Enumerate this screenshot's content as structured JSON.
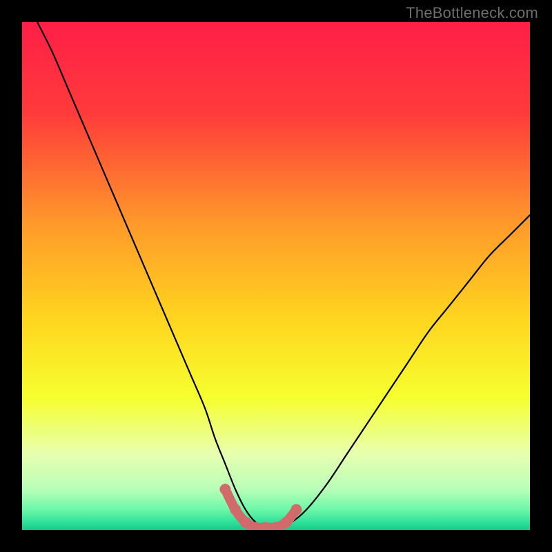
{
  "watermark": "TheBottleneck.com",
  "colors": {
    "curve": "#000000",
    "highlight": "#d16a6a",
    "frame": "#000000"
  },
  "chart_data": {
    "type": "line",
    "title": "",
    "xlabel": "",
    "ylabel": "",
    "xlim": [
      0,
      100
    ],
    "ylim": [
      0,
      100
    ],
    "grid": false,
    "series": [
      {
        "name": "bottleneck-curve",
        "x": [
          3,
          6,
          9,
          12,
          15,
          18,
          21,
          24,
          27,
          30,
          33,
          36,
          38,
          40,
          42,
          44,
          46,
          48,
          50,
          53,
          56,
          60,
          64,
          68,
          72,
          76,
          80,
          84,
          88,
          92,
          96,
          100
        ],
        "y": [
          100,
          94,
          87,
          80,
          73,
          66,
          59,
          52,
          45,
          38,
          31,
          24,
          18,
          13,
          8,
          4,
          1.5,
          0.5,
          0.5,
          1.5,
          4,
          9,
          15,
          21,
          27,
          33,
          39,
          44,
          49,
          54,
          58,
          62
        ]
      }
    ],
    "highlight_segment": {
      "name": "flat-minimum",
      "x": [
        40,
        42,
        44,
        46,
        48,
        50,
        52,
        54
      ],
      "y": [
        8,
        4,
        1.5,
        0.5,
        0.5,
        0.5,
        1.5,
        4
      ]
    },
    "background_gradient": {
      "stops": [
        {
          "offset": 0.0,
          "color": "#ff1f47"
        },
        {
          "offset": 0.18,
          "color": "#ff3b3b"
        },
        {
          "offset": 0.4,
          "color": "#ff9a2a"
        },
        {
          "offset": 0.58,
          "color": "#ffd41f"
        },
        {
          "offset": 0.74,
          "color": "#f6ff2e"
        },
        {
          "offset": 0.85,
          "color": "#e8ffb0"
        },
        {
          "offset": 0.92,
          "color": "#b8ffb8"
        },
        {
          "offset": 0.96,
          "color": "#6cf7a8"
        },
        {
          "offset": 0.985,
          "color": "#2fe09a"
        },
        {
          "offset": 1.0,
          "color": "#18c888"
        }
      ]
    }
  }
}
